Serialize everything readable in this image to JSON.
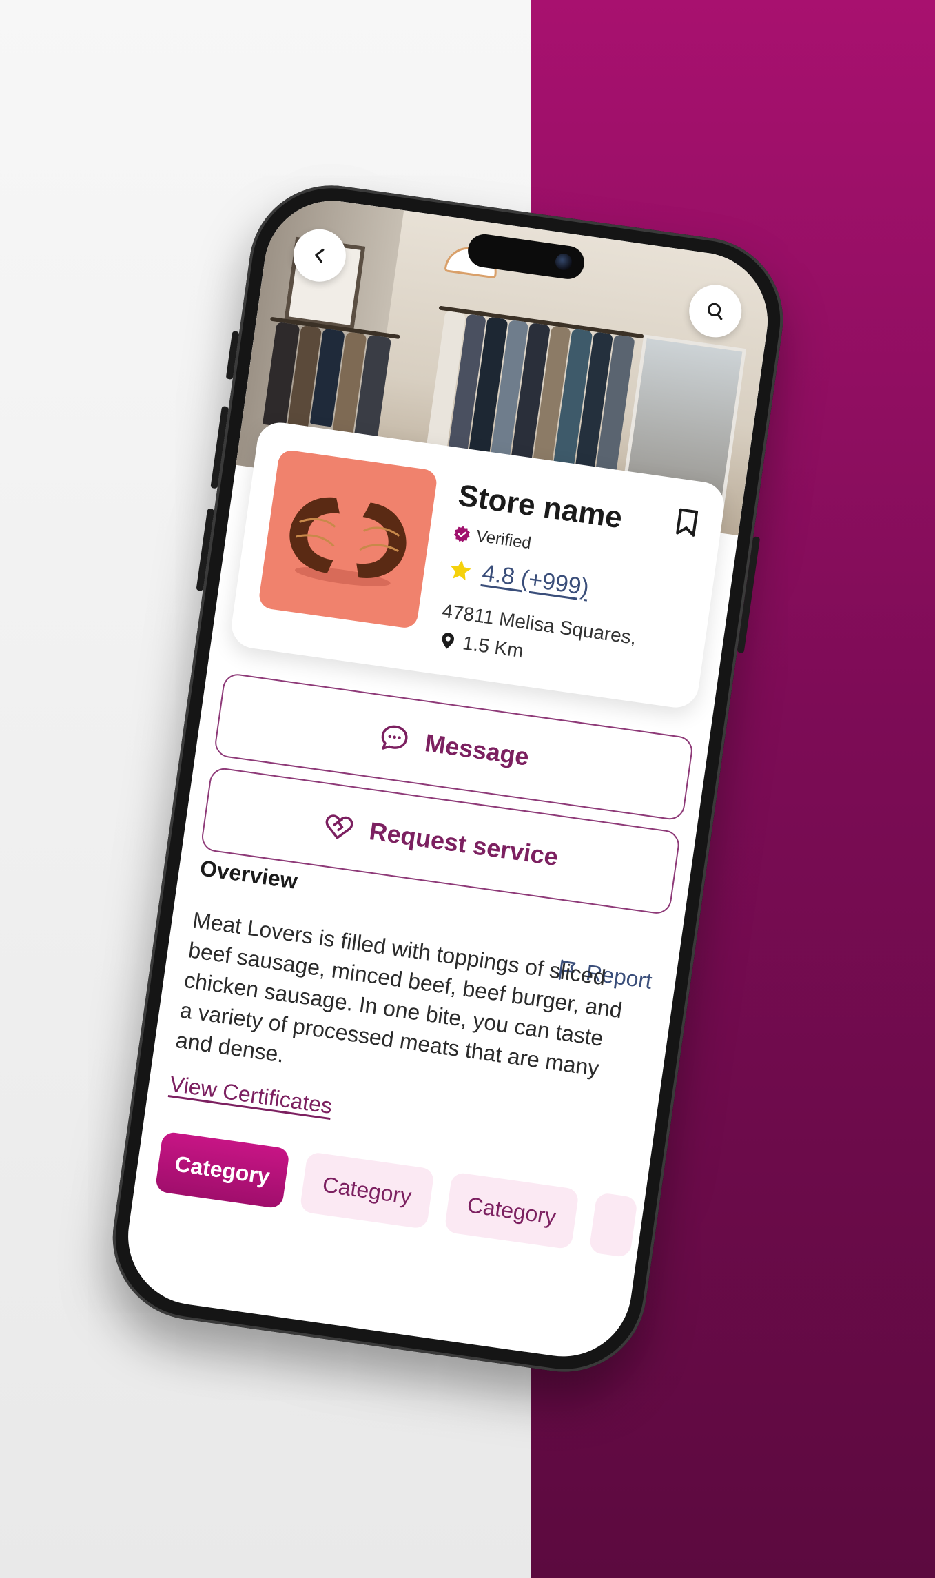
{
  "store": {
    "name": "Store name",
    "verified_label": "Verified",
    "rating": "4.8 (+999)",
    "address": "47811 Melisa Squares,",
    "distance": "1.5 Km"
  },
  "actions": {
    "message_label": "Message",
    "request_label": "Request service"
  },
  "overview": {
    "title": "Overview",
    "report_label": "Report",
    "text": "Meat Lovers is filled with toppings of sliced beef sausage, minced beef, beef burger, and chicken sausage. In one bite, you can taste a variety of processed meats that are many and dense.",
    "certificates_link": "View Certificates"
  },
  "categories": [
    "Category",
    "Category",
    "Category"
  ],
  "icons": {
    "back": "chevron-left-icon",
    "search": "search-icon",
    "bookmark": "bookmark-icon",
    "verified": "verified-badge-icon",
    "star": "star-icon",
    "location": "location-pin-icon",
    "message": "chat-bubble-icon",
    "request": "heart-handshake-icon",
    "report": "flag-icon"
  },
  "colors": {
    "brand": "#7c2060",
    "brand_active": "#c71585",
    "chip_inactive_bg": "#fbe9f3",
    "logo_tile_bg": "#f0826d",
    "star": "#f5d10c",
    "link_blue": "#3a4e7a"
  }
}
